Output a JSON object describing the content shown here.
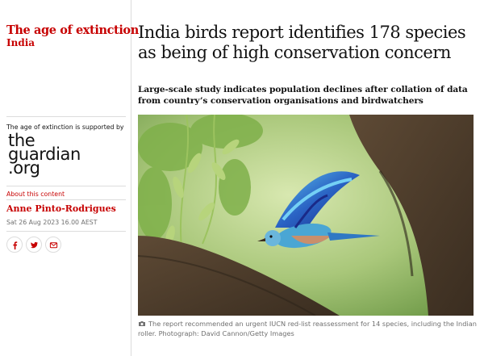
{
  "series": {
    "name": "The age of extinction",
    "subseries": "India"
  },
  "sponsor": {
    "supported_text": "The age of extinction is supported by",
    "logo_lines": [
      "the",
      "guardian",
      ".org"
    ]
  },
  "about_link": "About this content",
  "author": "Anne Pinto-Rodrigues",
  "date": "Sat 26 Aug 2023 16.00 AEST",
  "share_icons": [
    "facebook-icon",
    "twitter-icon",
    "email-icon"
  ],
  "headline": "India birds report identifies 178 species as being of high conservation concern",
  "standfirst": "Large-scale study indicates population declines after collation of data from country’s conservation organisations and birdwatchers",
  "caption": {
    "icon": "camera-icon",
    "text": "The report recommended an urgent IUCN red-list reassessment for 14 species, including the Indian roller. Photograph: David Cannon/Getty Images"
  },
  "colors": {
    "accent": "#c70000",
    "text": "#121212",
    "secondary": "#707070",
    "rule": "#dcdcdc"
  }
}
